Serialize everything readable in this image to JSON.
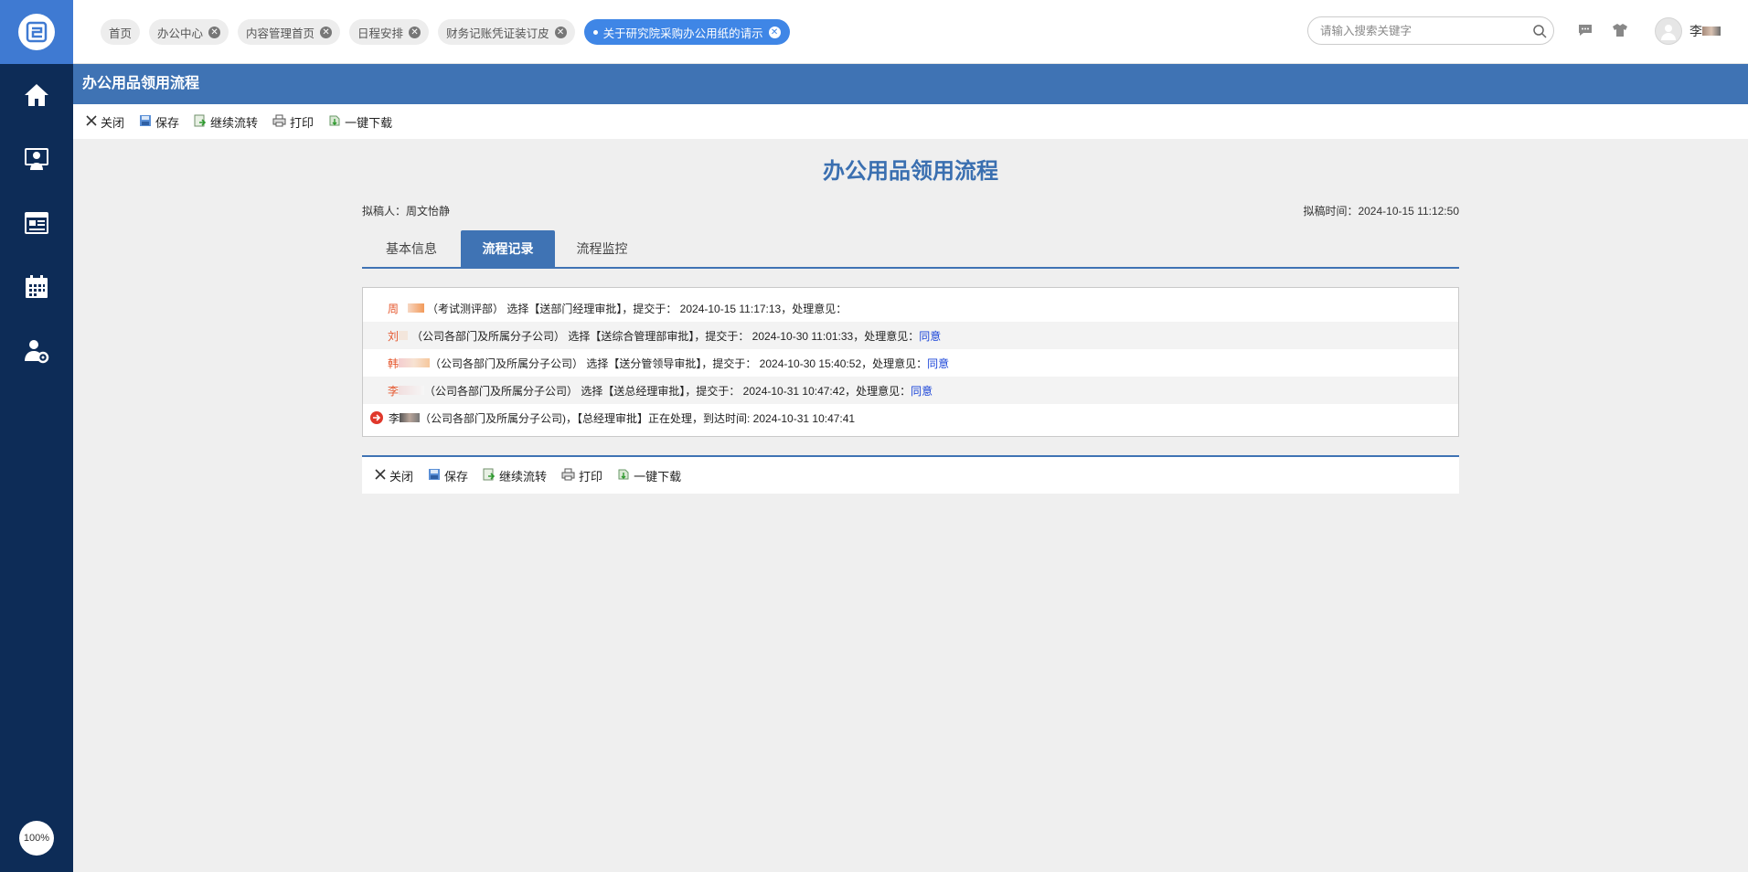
{
  "topbar": {
    "tabs": [
      {
        "label": "首页",
        "closable": false
      },
      {
        "label": "办公中心",
        "closable": true
      },
      {
        "label": "内容管理首页",
        "closable": true
      },
      {
        "label": "日程安排",
        "closable": true
      },
      {
        "label": "财务记账凭证装订皮",
        "closable": true
      },
      {
        "label": "关于研究院采购办公用纸的请示",
        "closable": true,
        "active": true
      }
    ],
    "search_placeholder": "请输入搜索关键字",
    "user_name": "李"
  },
  "sidebar": {
    "items": [
      "home-icon",
      "contacts-icon",
      "news-icon",
      "calendar-icon",
      "user-settings-icon"
    ],
    "zoom": "100%"
  },
  "page": {
    "title_bar": "办公用品领用流程",
    "toolbar": {
      "close": "关闭",
      "save": "保存",
      "continue": "继续流转",
      "print": "打印",
      "download": "一键下载"
    },
    "doc_title": "办公用品领用流程",
    "drafter": "拟稿人：周文怡静",
    "draft_time": "拟稿时间：2024-10-15 11:12:50",
    "form_tabs": [
      "基本信息",
      "流程记录",
      "流程监控"
    ],
    "active_tab": "流程记录",
    "records": [
      {
        "actor": "周",
        "text": "（考试测评部） 选择【送部门经理审批】，提交于： 2024-10-15 11:17:13，处理意见：",
        "opinion": ""
      },
      {
        "actor": "刘",
        "text": "（公司各部门及所属分子公司） 选择【送综合管理部审批】，提交于： 2024-10-30 11:01:33，处理意见：",
        "opinion": "同意"
      },
      {
        "actor": "韩",
        "text": "（公司各部门及所属分子公司） 选择【送分管领导审批】，提交于： 2024-10-30 15:40:52，处理意见：",
        "opinion": "同意"
      },
      {
        "actor": "李",
        "text": "（公司各部门及所属分子公司） 选择【送总经理审批】，提交于： 2024-10-31 10:47:42，处理意见：",
        "opinion": "同意"
      }
    ],
    "current_record": {
      "actor": "李",
      "text": "（公司各部门及所属分子公司)，【总经理审批】正在处理，到达时间: 2024-10-31 10:47:41"
    }
  }
}
